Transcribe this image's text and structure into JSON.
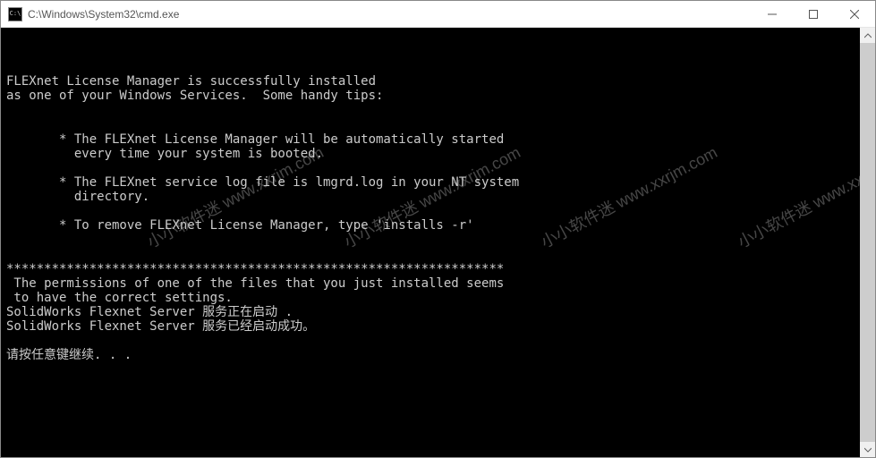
{
  "window": {
    "title": "C:\\Windows\\System32\\cmd.exe",
    "icon_label": "C:\\"
  },
  "console": {
    "lines": [
      "",
      "FLEXnet License Manager is successfully installed",
      "as one of your Windows Services.  Some handy tips:",
      "",
      "",
      "       * The FLEXnet License Manager will be automatically started",
      "         every time your system is booted.",
      "",
      "       * The FLEXnet service log file is lmgrd.log in your NT system",
      "         directory.",
      "",
      "       * To remove FLEXnet License Manager, type 'installs -r'",
      "",
      "",
      "******************************************************************",
      " The permissions of one of the files that you just installed seems",
      " to have the correct settings.",
      "SolidWorks Flexnet Server 服务正在启动 .",
      "SolidWorks Flexnet Server 服务已经启动成功。",
      "",
      "请按任意键继续. . ."
    ]
  },
  "watermark": {
    "text": "小小软件迷 www.xxrjm.com"
  }
}
